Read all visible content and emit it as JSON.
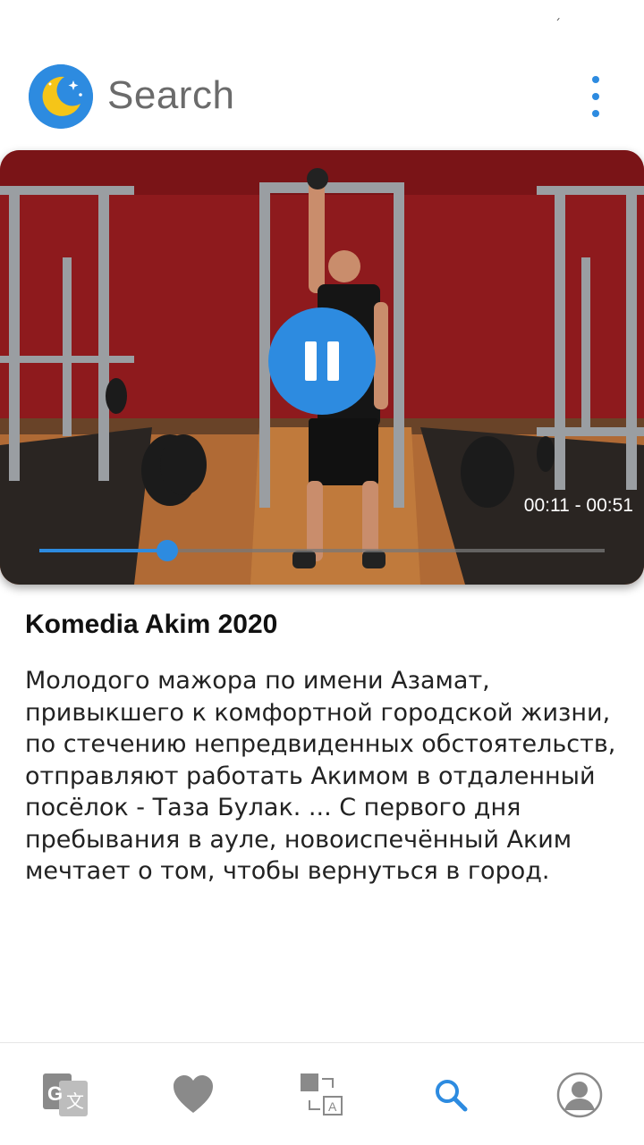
{
  "header": {
    "search_label": "Search"
  },
  "player": {
    "state": "playing",
    "time_text": "00:11 - 00:51",
    "progress_fraction": 0.226
  },
  "video": {
    "title": "Komedia Akim 2020",
    "description": "Молодого мажора по имени Азамат, привыкшего к комфортной городской жизни, по стечению непредвиденных обстоятельств, отправляют работать Акимом в отдаленный посёлок - Таза Булак. ... С первого дня пребывания в ауле, новоиспечённый Аким мечтает о том, чтобы вернуться в город."
  },
  "bottom_nav": {
    "items": [
      {
        "icon": "google-translate-icon",
        "active": false
      },
      {
        "icon": "heart-icon",
        "active": false
      },
      {
        "icon": "translate-swap-icon",
        "active": false
      },
      {
        "icon": "search-icon",
        "active": true
      },
      {
        "icon": "account-icon",
        "active": false
      }
    ]
  },
  "colors": {
    "accent": "#2d8be0",
    "inactive_icon": "#8a8a8a"
  }
}
